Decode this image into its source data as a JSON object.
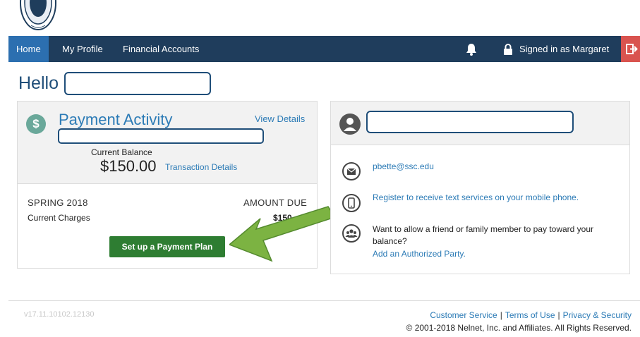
{
  "nav": {
    "home": "Home",
    "profile": "My Profile",
    "financial": "Financial Accounts",
    "signed_in": "Signed in as Margaret"
  },
  "greeting": "Hello",
  "payment": {
    "title": "Payment Activity",
    "view_details": "View Details",
    "current_balance_label": "Current Balance",
    "current_balance_value": "$150.00",
    "transaction_details": "Transaction Details",
    "term": "SPRING 2018",
    "amount_due_label": "AMOUNT DUE",
    "current_charges_label": "Current Charges",
    "current_charges_value": "$150",
    "plan_button": "Set up a Payment Plan"
  },
  "contact": {
    "email": "pbette@ssc.edu",
    "text_services": "Register to receive text services on your mobile phone.",
    "friend_prompt": "Want to allow a friend or family member to pay toward your balance?",
    "authorized_party": "Add an Authorized Party."
  },
  "footer": {
    "version": "v17.11.10102.12130",
    "customer_service": "Customer Service",
    "terms": "Terms of Use",
    "privacy": "Privacy & Security",
    "separator": "|",
    "copyright": "© 2001-2018 Nelnet, Inc. and Affiliates. All Rights Reserved."
  },
  "colors": {
    "navbar": "#1f3d5c",
    "nav_active": "#2c6fb0",
    "link": "#2c7bb6",
    "button": "#2e7d32",
    "arrow": "#7cb342",
    "exit": "#d9534f"
  },
  "icons": [
    "seal-logo",
    "bell-icon",
    "lock-icon",
    "sign-out-icon",
    "dollar-icon",
    "user-icon",
    "envelope-icon",
    "mobile-phone-icon",
    "people-icon",
    "arrow-icon"
  ]
}
